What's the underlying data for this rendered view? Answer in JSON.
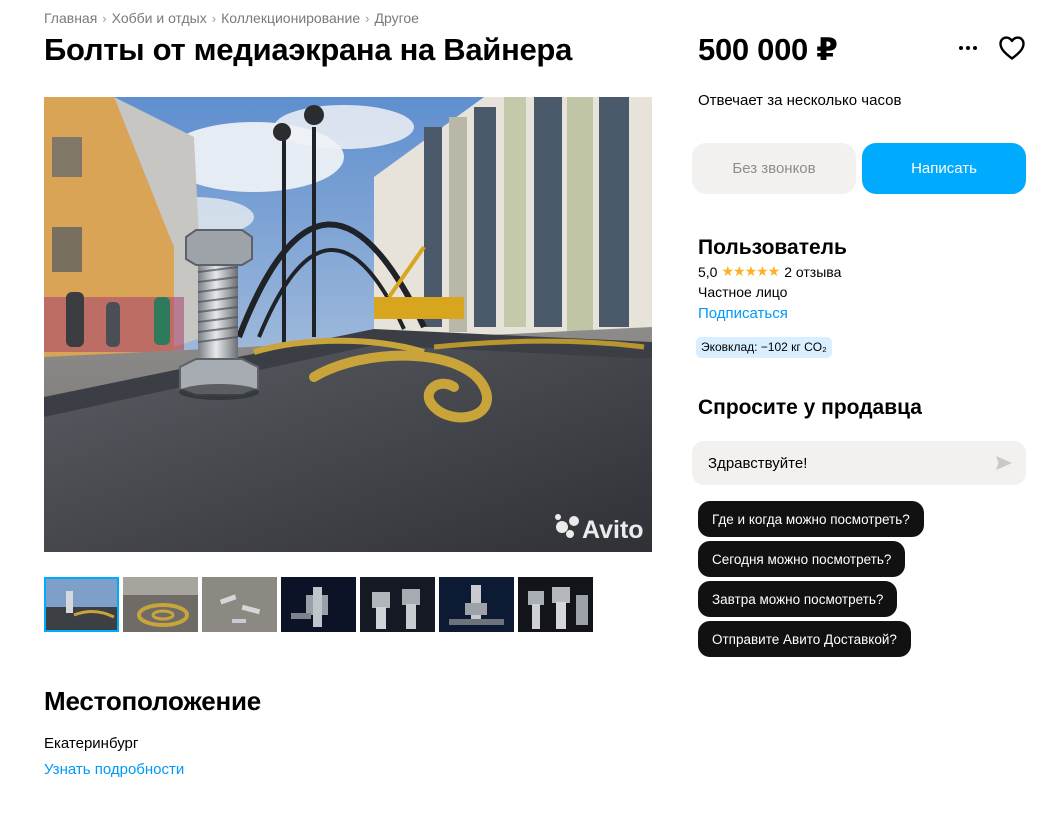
{
  "breadcrumbs": [
    "Главная",
    "Хобби и отдых",
    "Коллекционирование",
    "Другое"
  ],
  "breadcrumb_separator": "›",
  "listing": {
    "title": "Болты от медиаэкрана на Вайнера",
    "price": "500 000 ₽",
    "response_time": "Отвечает за несколько часов",
    "watermark": "Avito"
  },
  "actions": {
    "no_calls_label": "Без звонков",
    "write_label": "Написать",
    "more_icon": "more-dots-icon",
    "favorite_icon": "heart-icon"
  },
  "gallery": {
    "thumbnail_count": 7,
    "active_index": 0
  },
  "seller": {
    "name": "Пользователь",
    "rating": "5,0",
    "stars": "★★★★★",
    "stars_value": 5,
    "reviews": "2 отзыва",
    "type": "Частное лицо",
    "subscribe": "Подписаться",
    "eco": "Эковклад: −102 кг CO₂"
  },
  "ask": {
    "title": "Спросите у продавца",
    "input_value": "Здравствуйте!",
    "quick_questions": [
      "Где и когда можно посмотреть?",
      "Сегодня можно посмотреть?",
      "Завтра можно посмотреть?",
      "Отправите Авито Доставкой?"
    ]
  },
  "location": {
    "title": "Местоположение",
    "city": "Екатеринбург",
    "details_link": "Узнать подробности"
  },
  "colors": {
    "accent": "#00aaff",
    "link": "#0099f7",
    "star": "#ffb021",
    "chip_bg": "#111111",
    "eco_bg": "#d9efff"
  }
}
